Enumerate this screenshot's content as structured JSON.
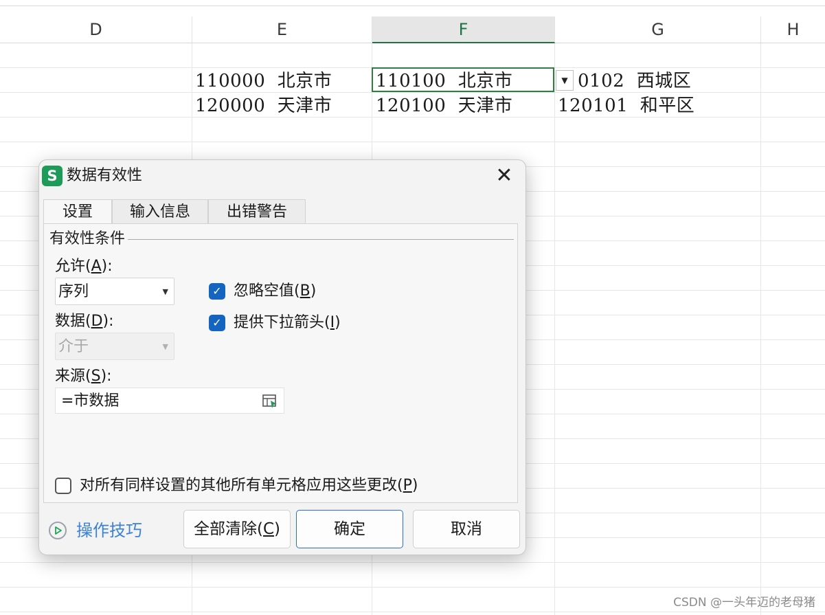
{
  "sheet": {
    "columns": [
      "D",
      "E",
      "F",
      "G",
      "H"
    ],
    "active_column": "F",
    "cells": {
      "E2": "110000  北京市",
      "E3": "120000  天津市",
      "F2": "110100  北京市",
      "F3": "120100  天津市",
      "G2": "0102  西城区",
      "G3": "120101  和平区"
    }
  },
  "dialog": {
    "title": "数据有效性",
    "app_icon_letter": "S",
    "close_glyph": "✕",
    "tabs": [
      {
        "label": "设置",
        "active": true
      },
      {
        "label": "输入信息",
        "active": false
      },
      {
        "label": "出错警告",
        "active": false
      }
    ],
    "section_title": "有效性条件",
    "allow": {
      "label_prefix": "允许(",
      "label_key": "A",
      "label_suffix": "):",
      "value": "序列"
    },
    "data": {
      "label_prefix": "数据(",
      "label_key": "D",
      "label_suffix": "):",
      "value": "介于",
      "enabled": false
    },
    "source": {
      "label_prefix": "来源(",
      "label_key": "S",
      "label_suffix": "):",
      "value": "=市数据"
    },
    "ignore_blank": {
      "label_prefix": "忽略空值(",
      "label_key": "B",
      "label_suffix": ")",
      "checked": true
    },
    "dropdown_arrow": {
      "label_prefix": "提供下拉箭头(",
      "label_key": "I",
      "label_suffix": ")",
      "checked": true
    },
    "apply_all": {
      "label_prefix": "对所有同样设置的其他所有单元格应用这些更改(",
      "label_key": "P",
      "label_suffix": ")",
      "checked": false
    },
    "tips_label": "操作技巧",
    "clear_all_prefix": "全部清除(",
    "clear_all_key": "C",
    "clear_all_suffix": ")",
    "ok_label": "确定",
    "cancel_label": "取消"
  },
  "watermark": "CSDN @一头年迈的老母猪",
  "colors": {
    "accent_green": "#217346",
    "checkbox_blue": "#1565c0",
    "link_blue": "#3b82d6"
  }
}
